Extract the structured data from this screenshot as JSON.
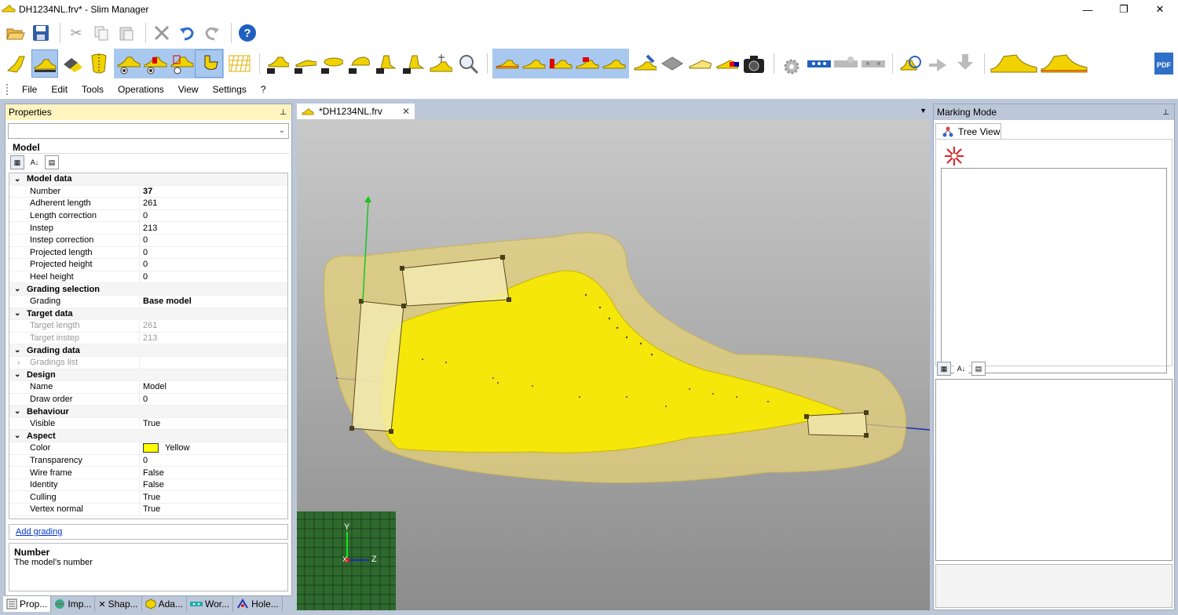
{
  "window": {
    "title": "DH1234NL.frv* - Slim Manager",
    "minimize": "—",
    "maximize": "❐",
    "close": "✕"
  },
  "menu": [
    "File",
    "Edit",
    "Tools",
    "Operations",
    "View",
    "Settings",
    "?"
  ],
  "properties": {
    "title": "Properties",
    "pin": "📌",
    "object_name": "Model",
    "categories": [
      {
        "name": "Model data",
        "rows": [
          {
            "key": "Number",
            "value": "37",
            "bold": true
          },
          {
            "key": "Adherent length",
            "value": "261"
          },
          {
            "key": "Length correction",
            "value": "0"
          },
          {
            "key": "Instep",
            "value": "213"
          },
          {
            "key": "Instep correction",
            "value": "0"
          },
          {
            "key": "Projected length",
            "value": "0"
          },
          {
            "key": "Projected height",
            "value": "0"
          },
          {
            "key": "Heel height",
            "value": "0"
          }
        ]
      },
      {
        "name": "Grading selection",
        "rows": [
          {
            "key": "Grading",
            "value": "Base model",
            "bold": true
          }
        ]
      },
      {
        "name": "Target data",
        "rows": [
          {
            "key": "Target length",
            "value": "261",
            "disabled": true
          },
          {
            "key": "Target instep",
            "value": "213",
            "disabled": true
          }
        ]
      },
      {
        "name": "Grading data",
        "rows": [
          {
            "key": "Gradings list",
            "value": "",
            "disabled": true,
            "expander": true
          }
        ]
      },
      {
        "name": "Design",
        "rows": [
          {
            "key": "Name",
            "value": "Model"
          },
          {
            "key": "Draw order",
            "value": "0"
          }
        ]
      },
      {
        "name": "Behaviour",
        "rows": [
          {
            "key": "Visible",
            "value": "True"
          }
        ]
      },
      {
        "name": "Aspect",
        "rows": [
          {
            "key": "Color",
            "value": "Yellow",
            "swatch": "#ffff00"
          },
          {
            "key": "Transparency",
            "value": "0"
          },
          {
            "key": "Wire frame",
            "value": "False"
          },
          {
            "key": "Identity",
            "value": "False"
          },
          {
            "key": "Culling",
            "value": "True"
          },
          {
            "key": "Vertex normal",
            "value": "True"
          }
        ]
      }
    ],
    "add_grading": "Add grading",
    "help_title": "Number",
    "help_text": "The model's number"
  },
  "bottom_tabs": [
    {
      "label": "Prop...",
      "icon": "properties-icon",
      "active": true
    },
    {
      "label": "Imp...",
      "icon": "import-icon"
    },
    {
      "label": "Shap...",
      "icon": "shape-icon"
    },
    {
      "label": "Ada...",
      "icon": "adapt-icon"
    },
    {
      "label": "Wor...",
      "icon": "work-icon"
    },
    {
      "label": "Hole...",
      "icon": "holes-icon"
    }
  ],
  "document": {
    "tab_label": "*DH1234NL.frv",
    "close": "✕",
    "axes": {
      "y": "Y",
      "z": "Z",
      "x": "X"
    }
  },
  "marking": {
    "title": "Marking Mode",
    "pin": "📌",
    "tree_tab": "Tree View"
  },
  "colors": {
    "accent_yellow": "#ffff00",
    "model_yellow": "#f5e70a",
    "panel_header": "#fdf4bf",
    "selection_blue": "#a8c8f0"
  }
}
